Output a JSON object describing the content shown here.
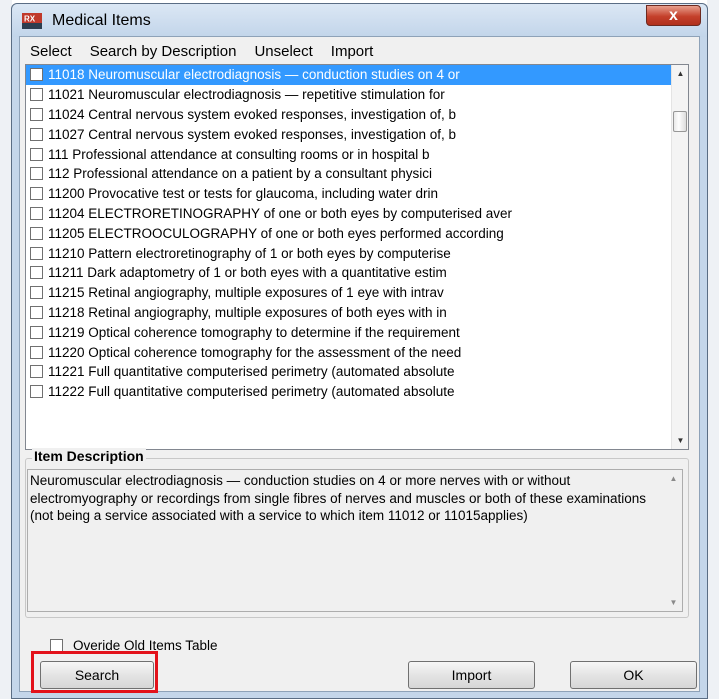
{
  "window": {
    "title": "Medical Items",
    "close_label": "x"
  },
  "menu": [
    "Select",
    "Search by Description",
    "Unselect",
    "Import"
  ],
  "items": [
    "11018 Neuromuscular electrodiagnosis — conduction studies on 4 or",
    "11021 Neuromuscular electrodiagnosis — repetitive stimulation for",
    "11024 Central nervous system evoked responses, investigation of, b",
    "11027 Central nervous system evoked responses, investigation of, b",
    "111 Professional attendance at consulting rooms or in hospital b",
    "112 Professional attendance on a patient by a consultant physici",
    "11200 Provocative test or tests for glaucoma, including water drin",
    "11204 ELECTRORETINOGRAPHY of one or both eyes by computerised aver",
    "11205 ELECTROOCULOGRAPHY of one or both eyes performed according",
    "11210 Pattern electroretinography of 1 or both eyes by computerise",
    "11211 Dark adaptometry of 1 or both eyes with a quantitative estim",
    "11215 Retinal angiography, multiple exposures of 1 eye with intrav",
    "11218 Retinal angiography, multiple exposures of both eyes with in",
    "11219 Optical coherence tomography to determine if the requirement",
    "11220 Optical coherence tomography for the assessment of the need",
    "11221 Full quantitative computerised perimetry (automated absolute",
    "11222 Full quantitative computerised perimetry (automated absolute"
  ],
  "selected_index": 0,
  "description": {
    "legend": "Item Description",
    "text": "Neuromuscular electrodiagnosis — conduction studies on 4 or more nerves with or without electromyography or recordings from single fibres of nerves and muscles or both of these examinations (not being a service associated with a service to which item 11012 or 11015applies)"
  },
  "override_label": "Overide Old Items Table",
  "buttons": {
    "search": "Search",
    "import": "Import",
    "ok": "OK"
  },
  "colors": {
    "selection": "#3399ff",
    "highlight": "#e3121b",
    "close": "#c4402b"
  }
}
